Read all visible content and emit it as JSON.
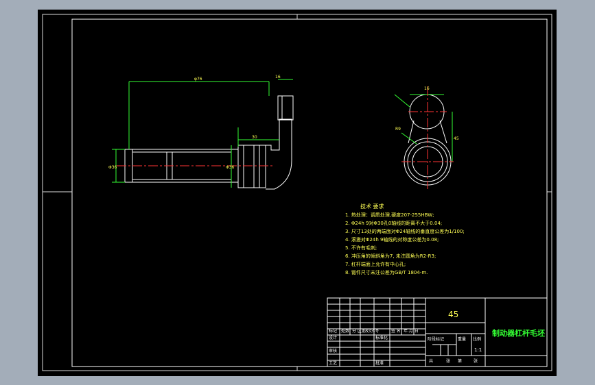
{
  "drawing": {
    "tech_requirements_title": "技术 要求",
    "tech_requirements": [
      "1. 热处理：调质处理,硬度207-255HBW;",
      "2. Φ24h 9对Φ30孔0轴线的距离不大于0.04;",
      "3. 尺寸13处的两端面对Φ24轴线的垂直度公差为1/100;",
      "4. 滚搓对Φ24h 9轴线的对称度公差为0.08;",
      "5. 不许有毛刺;",
      "6. 冲压角的倾斜角为7, 未注圆角为R2-R3;",
      "7. 杠杆端面上允许有中心孔;",
      "8. 锻件尺寸未注公差为GB/T 1804-m."
    ],
    "dims": {
      "top_length": "φ76",
      "top_small": "16",
      "mid_length": "30",
      "left_dia": "Φ36",
      "right_dia": "Φ36",
      "side_top": "16",
      "side_left": "R9",
      "side_right": "45"
    }
  },
  "title_block": {
    "material": "45",
    "part_name": "制动器杠杆毛坯",
    "scale": "1:1",
    "header_labels": [
      "标记",
      "处数",
      "分 区",
      "更改文件号",
      "签 名",
      "年.月.日"
    ],
    "row_design": "设计",
    "row_standard": "标准化",
    "row_check": "审核",
    "row_process": "工艺",
    "row_approve": "批准",
    "stage_labels": [
      "阶段标记",
      "重量",
      "比例"
    ],
    "sheet_labels": [
      "共",
      "张",
      "第",
      "张"
    ]
  },
  "colors": {
    "background": "#a3adb9",
    "sheet": "#000000",
    "lines": "#ffffff",
    "centerline": "#ff3333",
    "dimension": "#33ff33",
    "text": "#ffff55"
  }
}
